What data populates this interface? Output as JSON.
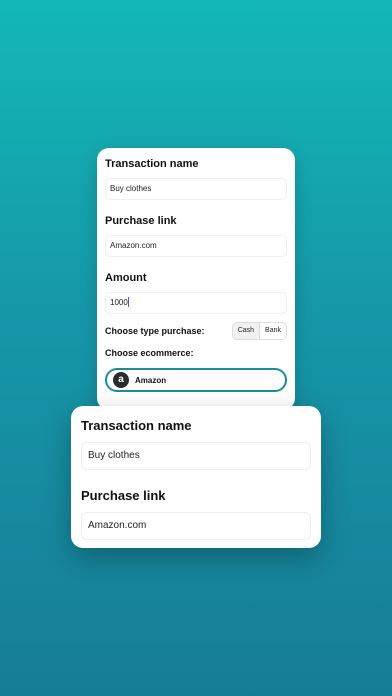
{
  "back_form": {
    "transaction_name_label": "Transaction name",
    "transaction_name_value": "Buy clothes",
    "purchase_link_label": "Purchase link",
    "purchase_link_value": "Amazon.com",
    "amount_label": "Amount",
    "amount_value": "1000",
    "type_label": "Choose type purchase:",
    "type_options": [
      "Cash",
      "Bank"
    ],
    "type_selected": "Bank",
    "ecommerce_label": "Choose ecommerce:",
    "ecommerce_selected": "Amazon",
    "ecommerce_logo_letter": "a"
  },
  "front_form": {
    "transaction_name_label": "Transaction name",
    "transaction_name_value": "Buy clothes",
    "purchase_link_label": "Purchase link",
    "purchase_link_value": "Amazon.com"
  },
  "colors": {
    "background_top": "#13b8b6",
    "background_bottom": "#177d97",
    "accent": "#1a8e98",
    "caret": "#5a45ff"
  }
}
